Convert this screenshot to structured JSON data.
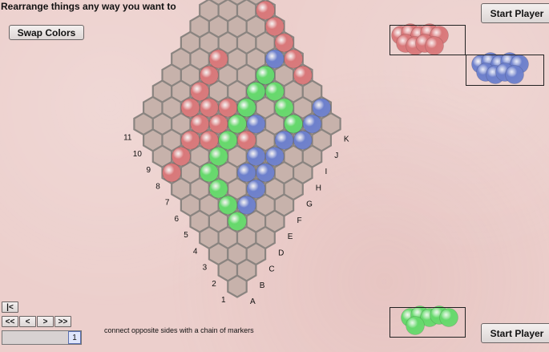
{
  "message": "Rearrange things any way you want to",
  "swap_label": "Swap Colors",
  "start_player_top": "Start Player",
  "start_player_bottom": "Start Player",
  "hint": "connect opposite sides with a chain of markers",
  "nav": {
    "first": "|<",
    "prev_fast": "<<",
    "prev": "<",
    "next": ">",
    "next_fast": ">>"
  },
  "move_number": "1",
  "board": {
    "size": 11,
    "col_labels": [
      "A",
      "B",
      "C",
      "D",
      "E",
      "F",
      "G",
      "H",
      "I",
      "J",
      "K"
    ],
    "row_labels": [
      "1",
      "2",
      "3",
      "4",
      "5",
      "6",
      "7",
      "8",
      "9",
      "10",
      "11"
    ],
    "colors": {
      "red": "#d9787a",
      "blue": "#6d80cc",
      "green": "#66d96c",
      "cell": "#c7b2ab",
      "edge": "#8a8480"
    },
    "stones": {
      "red": [
        [
          11,
          4
        ],
        [
          11,
          5
        ],
        [
          11,
          6
        ],
        [
          11,
          7
        ],
        [
          11,
          8
        ],
        [
          1,
          8
        ],
        [
          2,
          8
        ],
        [
          3,
          8
        ],
        [
          4,
          8
        ],
        [
          4,
          7
        ],
        [
          5,
          8
        ],
        [
          5,
          7
        ],
        [
          6,
          7
        ],
        [
          6,
          6
        ],
        [
          6,
          5
        ],
        [
          4,
          9
        ],
        [
          5,
          9
        ],
        [
          6,
          9
        ],
        [
          7,
          9
        ]
      ],
      "blue": [
        [
          10,
          6
        ],
        [
          9,
          6
        ],
        [
          8,
          6
        ],
        [
          7,
          6
        ],
        [
          7,
          5
        ],
        [
          6,
          4
        ],
        [
          5,
          4
        ],
        [
          4,
          3
        ],
        [
          5,
          3
        ],
        [
          6,
          3
        ],
        [
          7,
          3
        ],
        [
          8,
          3
        ],
        [
          9,
          3
        ],
        [
          9,
          2
        ],
        [
          10,
          2
        ],
        [
          11,
          2
        ]
      ],
      "green": [
        [
          3,
          6
        ],
        [
          3,
          5
        ],
        [
          3,
          4
        ],
        [
          3,
          3
        ],
        [
          4,
          6
        ],
        [
          5,
          6
        ],
        [
          6,
          6
        ],
        [
          7,
          6
        ],
        [
          8,
          6
        ],
        [
          9,
          6
        ],
        [
          9,
          5
        ],
        [
          9,
          4
        ],
        [
          9,
          3
        ]
      ],
      "tray_red": 9,
      "tray_blue": 9,
      "tray_green": 6
    }
  }
}
